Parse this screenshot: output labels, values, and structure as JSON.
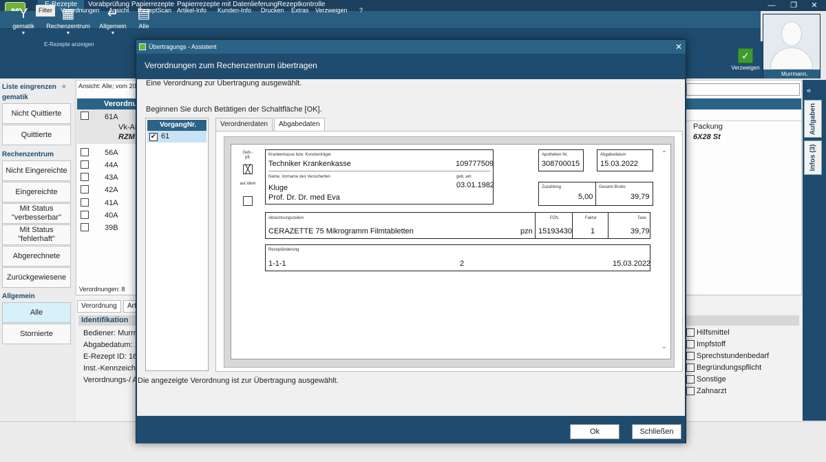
{
  "app": {
    "top_tabs": [
      "E-Rezepte",
      "Vorabprüfung Papierrezepte",
      "Papierrezepte mit Datenlieferung",
      "Rezeptkontrolle"
    ],
    "window_controls": [
      "—",
      "❐",
      "✕"
    ],
    "menu": [
      "Filter",
      "Verordnungen",
      "Ansicht",
      "RezeptScan",
      "Artikel-Info",
      "Kunden-Info",
      "Drucken",
      "Extras",
      "Verzweigen",
      "?"
    ],
    "ribbon": {
      "buttons": [
        {
          "label": "gematik",
          "icon": "Y"
        },
        {
          "label": "Rechenzentrum",
          "icon": "▦"
        },
        {
          "label": "Allgemein",
          "icon": "↵"
        },
        {
          "label": "Alle",
          "icon": "▤"
        }
      ],
      "group_label": "E-Rezepte anzeigen"
    },
    "verweigern_label": "Verzweigen",
    "user_name": "Murrmann, Gabi"
  },
  "sidebar": {
    "collapse": "«",
    "section1": "Liste eingrenzen gematik",
    "section1_line1": "Liste eingrenzen",
    "section1_line2": "gematik",
    "btn_nicht_quittierte": "Nicht Quittierte",
    "btn_quittierte": "Quittierte",
    "section2": "Rechenzentrum",
    "btn_nicht_eingereichte": "Nicht Eingereichte",
    "btn_eingereichte": "Eingereichte",
    "btn_verbesserbar_1": "Mit Status",
    "btn_verbesserbar_2": "\"verbesserbar\"",
    "btn_fehlerhaft_1": "Mit Status",
    "btn_fehlerhaft_2": "\"fehlerhaft\"",
    "btn_abgerechnete": "Abgerechnete",
    "btn_zurueck": "Zurückgewiesene",
    "section3": "Allgemein",
    "btn_alle": "Alle",
    "btn_stornierte": "Stornierte"
  },
  "main": {
    "ansicht": "Ansicht: Alle; vom 20",
    "col_verordnung": "Verordnu",
    "rows": [
      "61A",
      "56A",
      "44A",
      "43A",
      "42A",
      "41A",
      "40A",
      "39B"
    ],
    "vk": "Vk-Ar",
    "rzm": "RZM",
    "packung_label": "Packung",
    "packung_value": "6X28 St",
    "count": "Verordnungen: 8",
    "tab_verordnung": "Verordnung",
    "tab_art": "Art",
    "ident_title": "Identifikation",
    "ident_lines": [
      "Bediener: Murrm",
      "Abgabedatum: 1",
      "E-Rezept ID: 160",
      "Inst.-Kennzeiche",
      "Verordnungs-/ A"
    ],
    "checks": [
      "Hilfsmittel",
      "Impfstoff",
      "Sprechstundenbedarf",
      "Begründungspflicht",
      "Sonstige",
      "Zahnarzt"
    ]
  },
  "rightbar": {
    "collapse": "«",
    "tab_aufgaben": "Aufgaben",
    "tab_infos": "Infos (3)"
  },
  "dialog": {
    "title": "Übertragungs - Assistent",
    "close": "✕",
    "header": "Verordnungen zum Rechenzentrum übertragen",
    "line1": "Eine Verordnung zur Übertragung ausgewählt.",
    "line2": "Beginnen Sie durch Betätigen der Schaltfläche [OK].",
    "list_header": "VorgangNr.",
    "list_item": "61",
    "list_item_checked": "✔",
    "tab_verordner": "Verordnerdaten",
    "tab_abgabe": "Abgabedaten",
    "status": "Die angezeigte Verordnung ist zur Übertragung ausgewählt.",
    "ok": "Ok",
    "close_btn": "Schließen",
    "rx": {
      "gebpfl_label": "Geb.-pfl.",
      "gebpfl_mark": "╳",
      "autidem_label": "aut idem",
      "kasse_label": "Krankenkasse bzw. Konstenträger",
      "kasse_value": "Techniker Krankenkasse",
      "kasse_ik": "109777509",
      "name_label": "Name, Vorname des Versicherten",
      "geb_label": "geb. am",
      "name_line1": "Kluge",
      "name_line2": "Prof. Dr. Dr. med Eva",
      "geb_value": "03.01.1982",
      "apo_label": "Apotheken Nr.",
      "apo_value": "308700015",
      "abgabedatum_label": "Abgabedatum",
      "abgabedatum_value": "15.03.2022",
      "zuzahlung_label": "Zuzahlung",
      "zuzahlung_value": "5,00",
      "brutto_label": "Gesamt Brutto",
      "brutto_value": "39,79",
      "zeilen_label": "Abrechnungszeilen",
      "pzn_label": "PZN",
      "faktor_label": "Faktor",
      "taxe_label": "Taxe",
      "item_name": "CERAZETTE 75 Mikrogramm Filmtabletten",
      "item_pzn_prefix": "pzn",
      "item_pzn": "15193430",
      "item_faktor": "1",
      "item_taxe": "39,79",
      "aenderung_label": "Rezeptänderung",
      "aenderung_code": "1-1-1",
      "aenderung_num": "2",
      "aenderung_date": "15.03.2022"
    }
  }
}
